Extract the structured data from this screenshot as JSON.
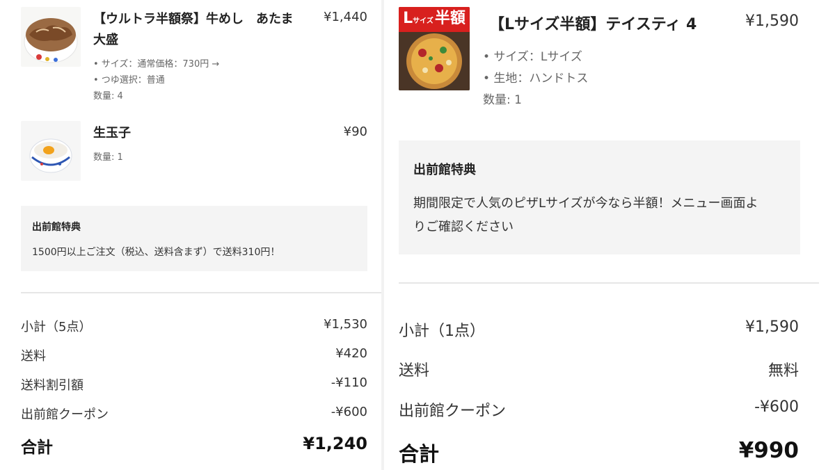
{
  "left": {
    "items": [
      {
        "name_line1": "【ウルトラ半額祭】牛めし　あたま",
        "name_line2": "大盛",
        "price": "¥1,440",
        "options": [
          "• サイズ：通常価格：730円 →",
          "• つゆ選択：普通"
        ],
        "qty": "数量: 4",
        "image": "gyumeshi-bowl-photo"
      },
      {
        "name_line1": "生玉子",
        "price": "¥90",
        "qty": "数量: 1",
        "image": "raw-egg-bowl-photo"
      }
    ],
    "note": {
      "title": "出前館特典",
      "body": "1500円以上ご注文（税込、送料含まず）で送料310円！"
    },
    "summary": [
      {
        "label": "小計（5点）",
        "value": "¥1,530"
      },
      {
        "label": "送料",
        "value": "¥420"
      },
      {
        "label": "送料割引額",
        "value": "-¥110"
      },
      {
        "label": "出前館クーポン",
        "value": "-¥600"
      }
    ],
    "total": {
      "label": "合計",
      "value": "¥1,240"
    }
  },
  "right": {
    "item": {
      "name": "【Lサイズ半額】テイスティ 4",
      "price": "¥1,590",
      "options": [
        "• サイズ：Lサイズ",
        "• 生地：ハンドトス"
      ],
      "qty": "数量: 1",
      "badge_l": "L",
      "badge_size": "サイズ",
      "badge_half": "半額",
      "image": "pizza-photo"
    },
    "note": {
      "title": "出前館特典",
      "body_line1": "期間限定で人気のピザLサイズが今なら半額！メニュー画面よ",
      "body_line2": "りご確認ください"
    },
    "summary": [
      {
        "label": "小計（1点）",
        "value": "¥1,590"
      },
      {
        "label": "送料",
        "value": "無料"
      },
      {
        "label": "出前館クーポン",
        "value": "-¥600"
      }
    ],
    "total": {
      "label": "合計",
      "value": "¥990"
    }
  },
  "colors": {
    "badge_red": "#d8201e",
    "note_bg": "#f4f4f4",
    "divider": "#e6e6e6"
  }
}
